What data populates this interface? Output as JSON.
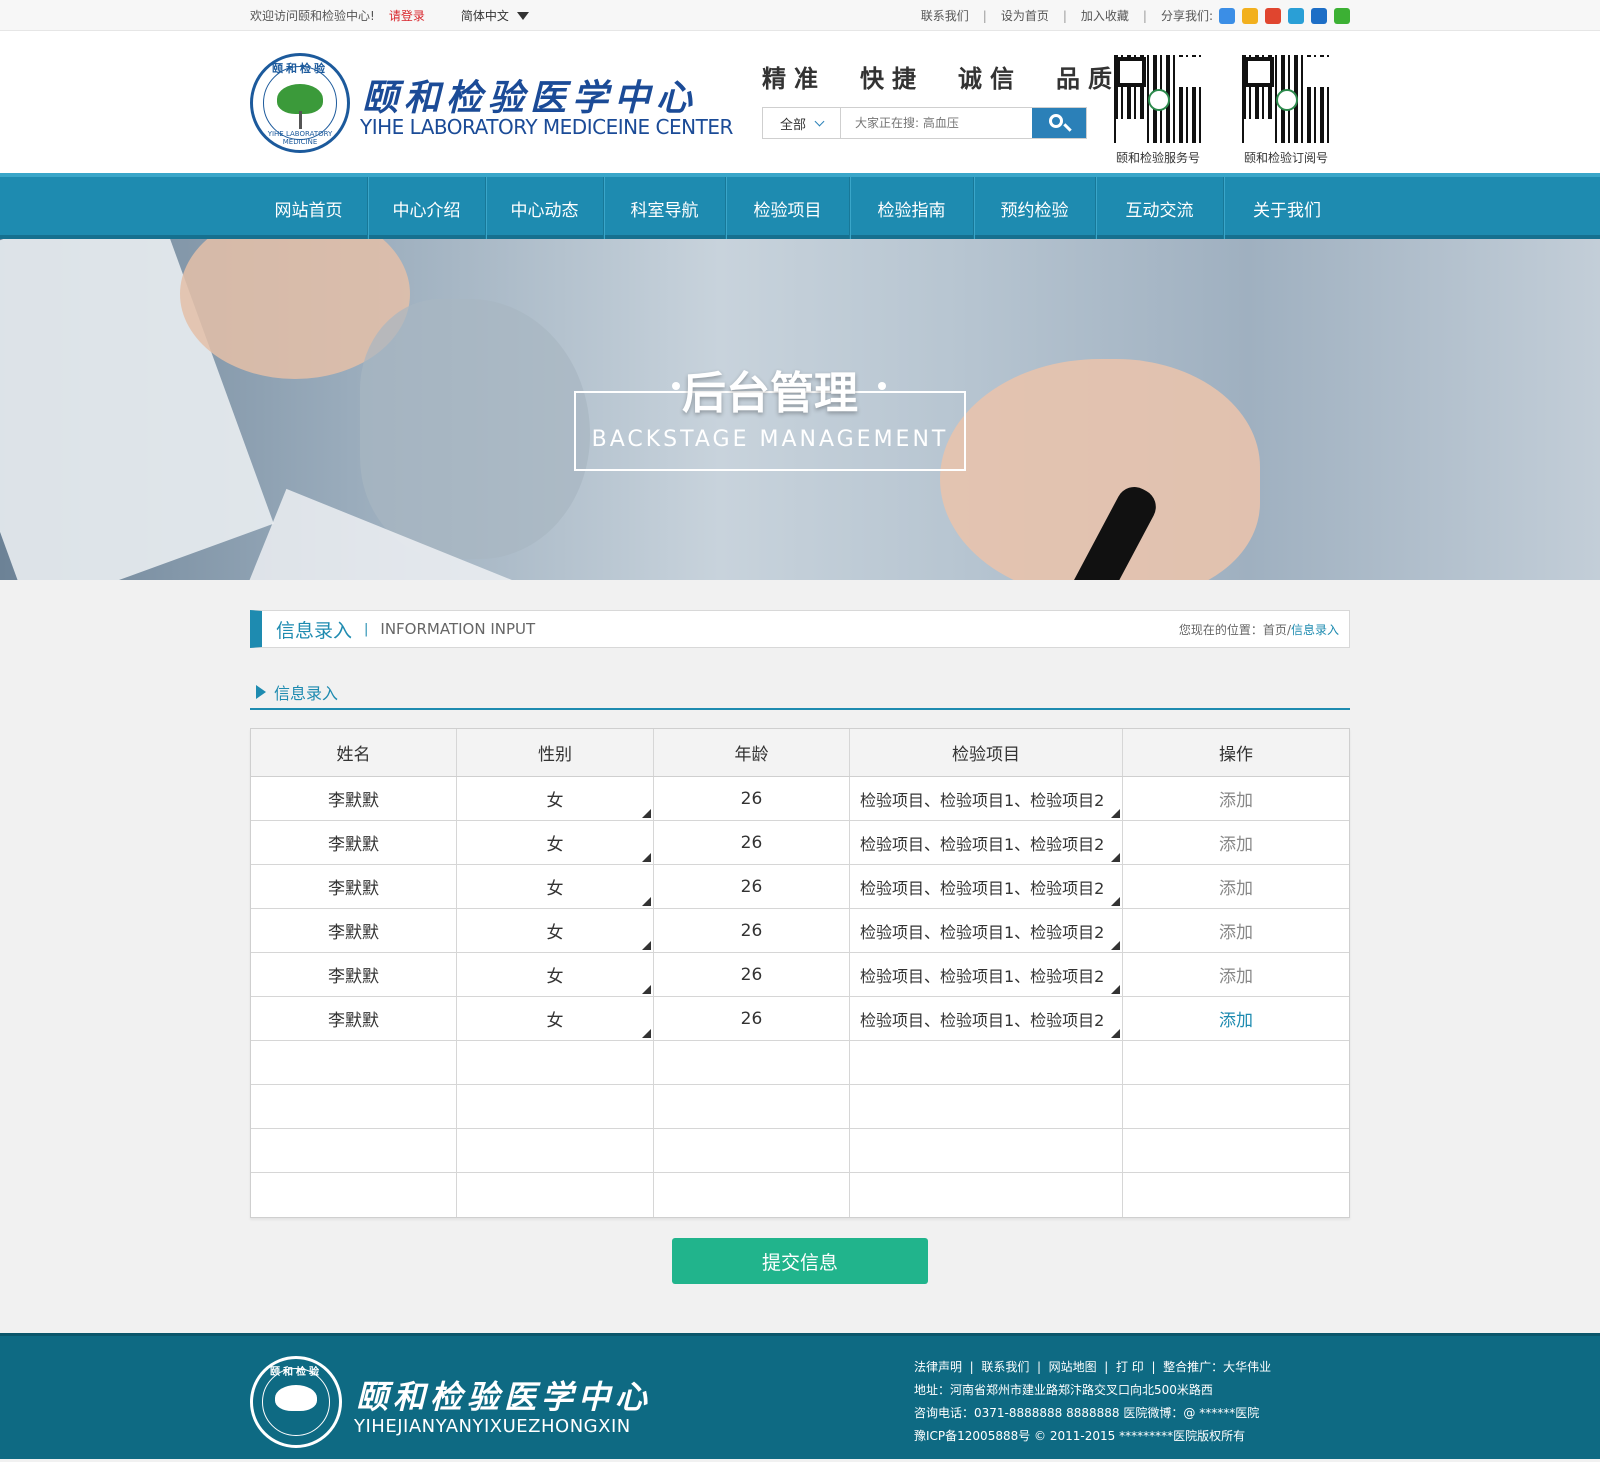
{
  "topbar": {
    "welcome": "欢迎访问颐和检验中心!",
    "login": "请登录",
    "language": "简体中文",
    "links": [
      "联系我们",
      "设为首页",
      "加入收藏"
    ],
    "share_label": "分享我们:",
    "share_icons": [
      {
        "name": "qzone-icon",
        "color": "#3b8ee6"
      },
      {
        "name": "star-icon",
        "color": "#f2b01e"
      },
      {
        "name": "weibo-icon",
        "color": "#e0452f"
      },
      {
        "name": "tencent-weibo-icon",
        "color": "#2a9fd6"
      },
      {
        "name": "renren-icon",
        "color": "#1d6ec6"
      },
      {
        "name": "wechat-icon",
        "color": "#3cb034"
      }
    ]
  },
  "header": {
    "brand_cn": "颐和检验医学中心",
    "brand_en": "YIHE LABORATORY MEDICEINE CENTER",
    "logo_ring_text": "颐和检验",
    "logo_ring_en": "YIHE LABORATORY MEDICINE",
    "slogans": [
      "精准",
      "快捷",
      "诚信",
      "品质"
    ],
    "search": {
      "scope": "全部",
      "placeholder": "大家正在搜: 高血压"
    },
    "qr_codes": [
      {
        "caption": "颐和检验服务号"
      },
      {
        "caption": "颐和检验订阅号"
      }
    ]
  },
  "nav": {
    "items": [
      "网站首页",
      "中心介绍",
      "中心动态",
      "科室导航",
      "检验项目",
      "检验指南",
      "预约检验",
      "互动交流",
      "关于我们"
    ]
  },
  "banner": {
    "title": "后台管理",
    "subtitle": "BACKSTAGE MANAGEMENT"
  },
  "breadcrumb": {
    "title_cn": "信息录入",
    "title_en": "INFORMATION INPUT",
    "location_label": "您现在的位置：",
    "home": "首页",
    "current": "信息录入"
  },
  "section": {
    "title": "信息录入"
  },
  "table": {
    "headers": [
      "姓名",
      "性别",
      "年龄",
      "检验项目",
      "操作"
    ],
    "rows": [
      {
        "name": "李默默",
        "gender": "女",
        "age": "26",
        "items": "检验项目、检验项目1、检验项目2",
        "action": "添加"
      },
      {
        "name": "李默默",
        "gender": "女",
        "age": "26",
        "items": "检验项目、检验项目1、检验项目2",
        "action": "添加"
      },
      {
        "name": "李默默",
        "gender": "女",
        "age": "26",
        "items": "检验项目、检验项目1、检验项目2",
        "action": "添加"
      },
      {
        "name": "李默默",
        "gender": "女",
        "age": "26",
        "items": "检验项目、检验项目1、检验项目2",
        "action": "添加"
      },
      {
        "name": "李默默",
        "gender": "女",
        "age": "26",
        "items": "检验项目、检验项目1、检验项目2",
        "action": "添加"
      },
      {
        "name": "李默默",
        "gender": "女",
        "age": "26",
        "items": "检验项目、检验项目1、检验项目2",
        "action": "添加"
      }
    ],
    "empty_rows": 4
  },
  "submit_label": "提交信息",
  "footer": {
    "brand_cn": "颐和检验医学中心",
    "brand_en": "YIHEJIANYANYIXUEZHONGXIN",
    "logo_ring_text": "颐和检验",
    "links": [
      "法律声明",
      "联系我们",
      "网站地图",
      "打 印",
      "整合推广：大华伟业"
    ],
    "address": "地址：河南省郑州市建业路郑汴路交叉口向北500米路西",
    "contact": "咨询电话：0371-8888888 8888888 医院微博：@ ******医院",
    "copyright": "豫ICP备12005888号 © 2011-2015 *********医院版权所有"
  },
  "colors": {
    "accent": "#1e8bb0",
    "brand_blue": "#1b4b97",
    "submit": "#21b48c",
    "footer_bg": "#0e6a83",
    "login_red": "#d8262c"
  }
}
